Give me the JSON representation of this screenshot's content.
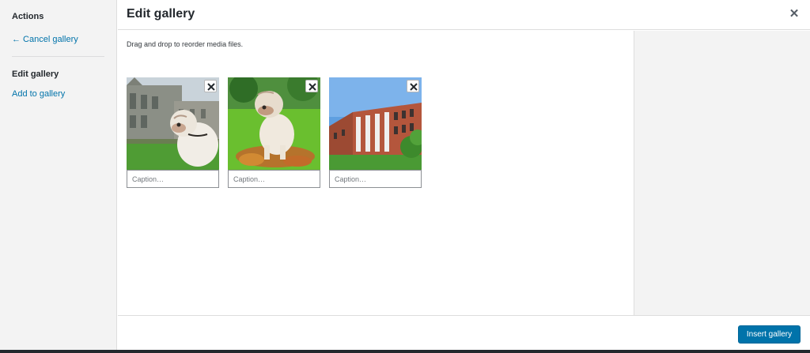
{
  "sidebar": {
    "heading": "Actions",
    "cancel_link": "← Cancel gallery",
    "active_item": "Edit gallery",
    "add_link": "Add to gallery"
  },
  "header": {
    "title": "Edit gallery"
  },
  "main": {
    "instructions": "Drag and drop to reorder media files.",
    "items": [
      {
        "caption_placeholder": "Caption…"
      },
      {
        "caption_placeholder": "Caption…"
      },
      {
        "caption_placeholder": "Caption…"
      }
    ]
  },
  "toolbar": {
    "insert_label": "Insert gallery"
  },
  "colors": {
    "accent": "#0073aa",
    "sidebar_bg": "#f3f3f3"
  }
}
